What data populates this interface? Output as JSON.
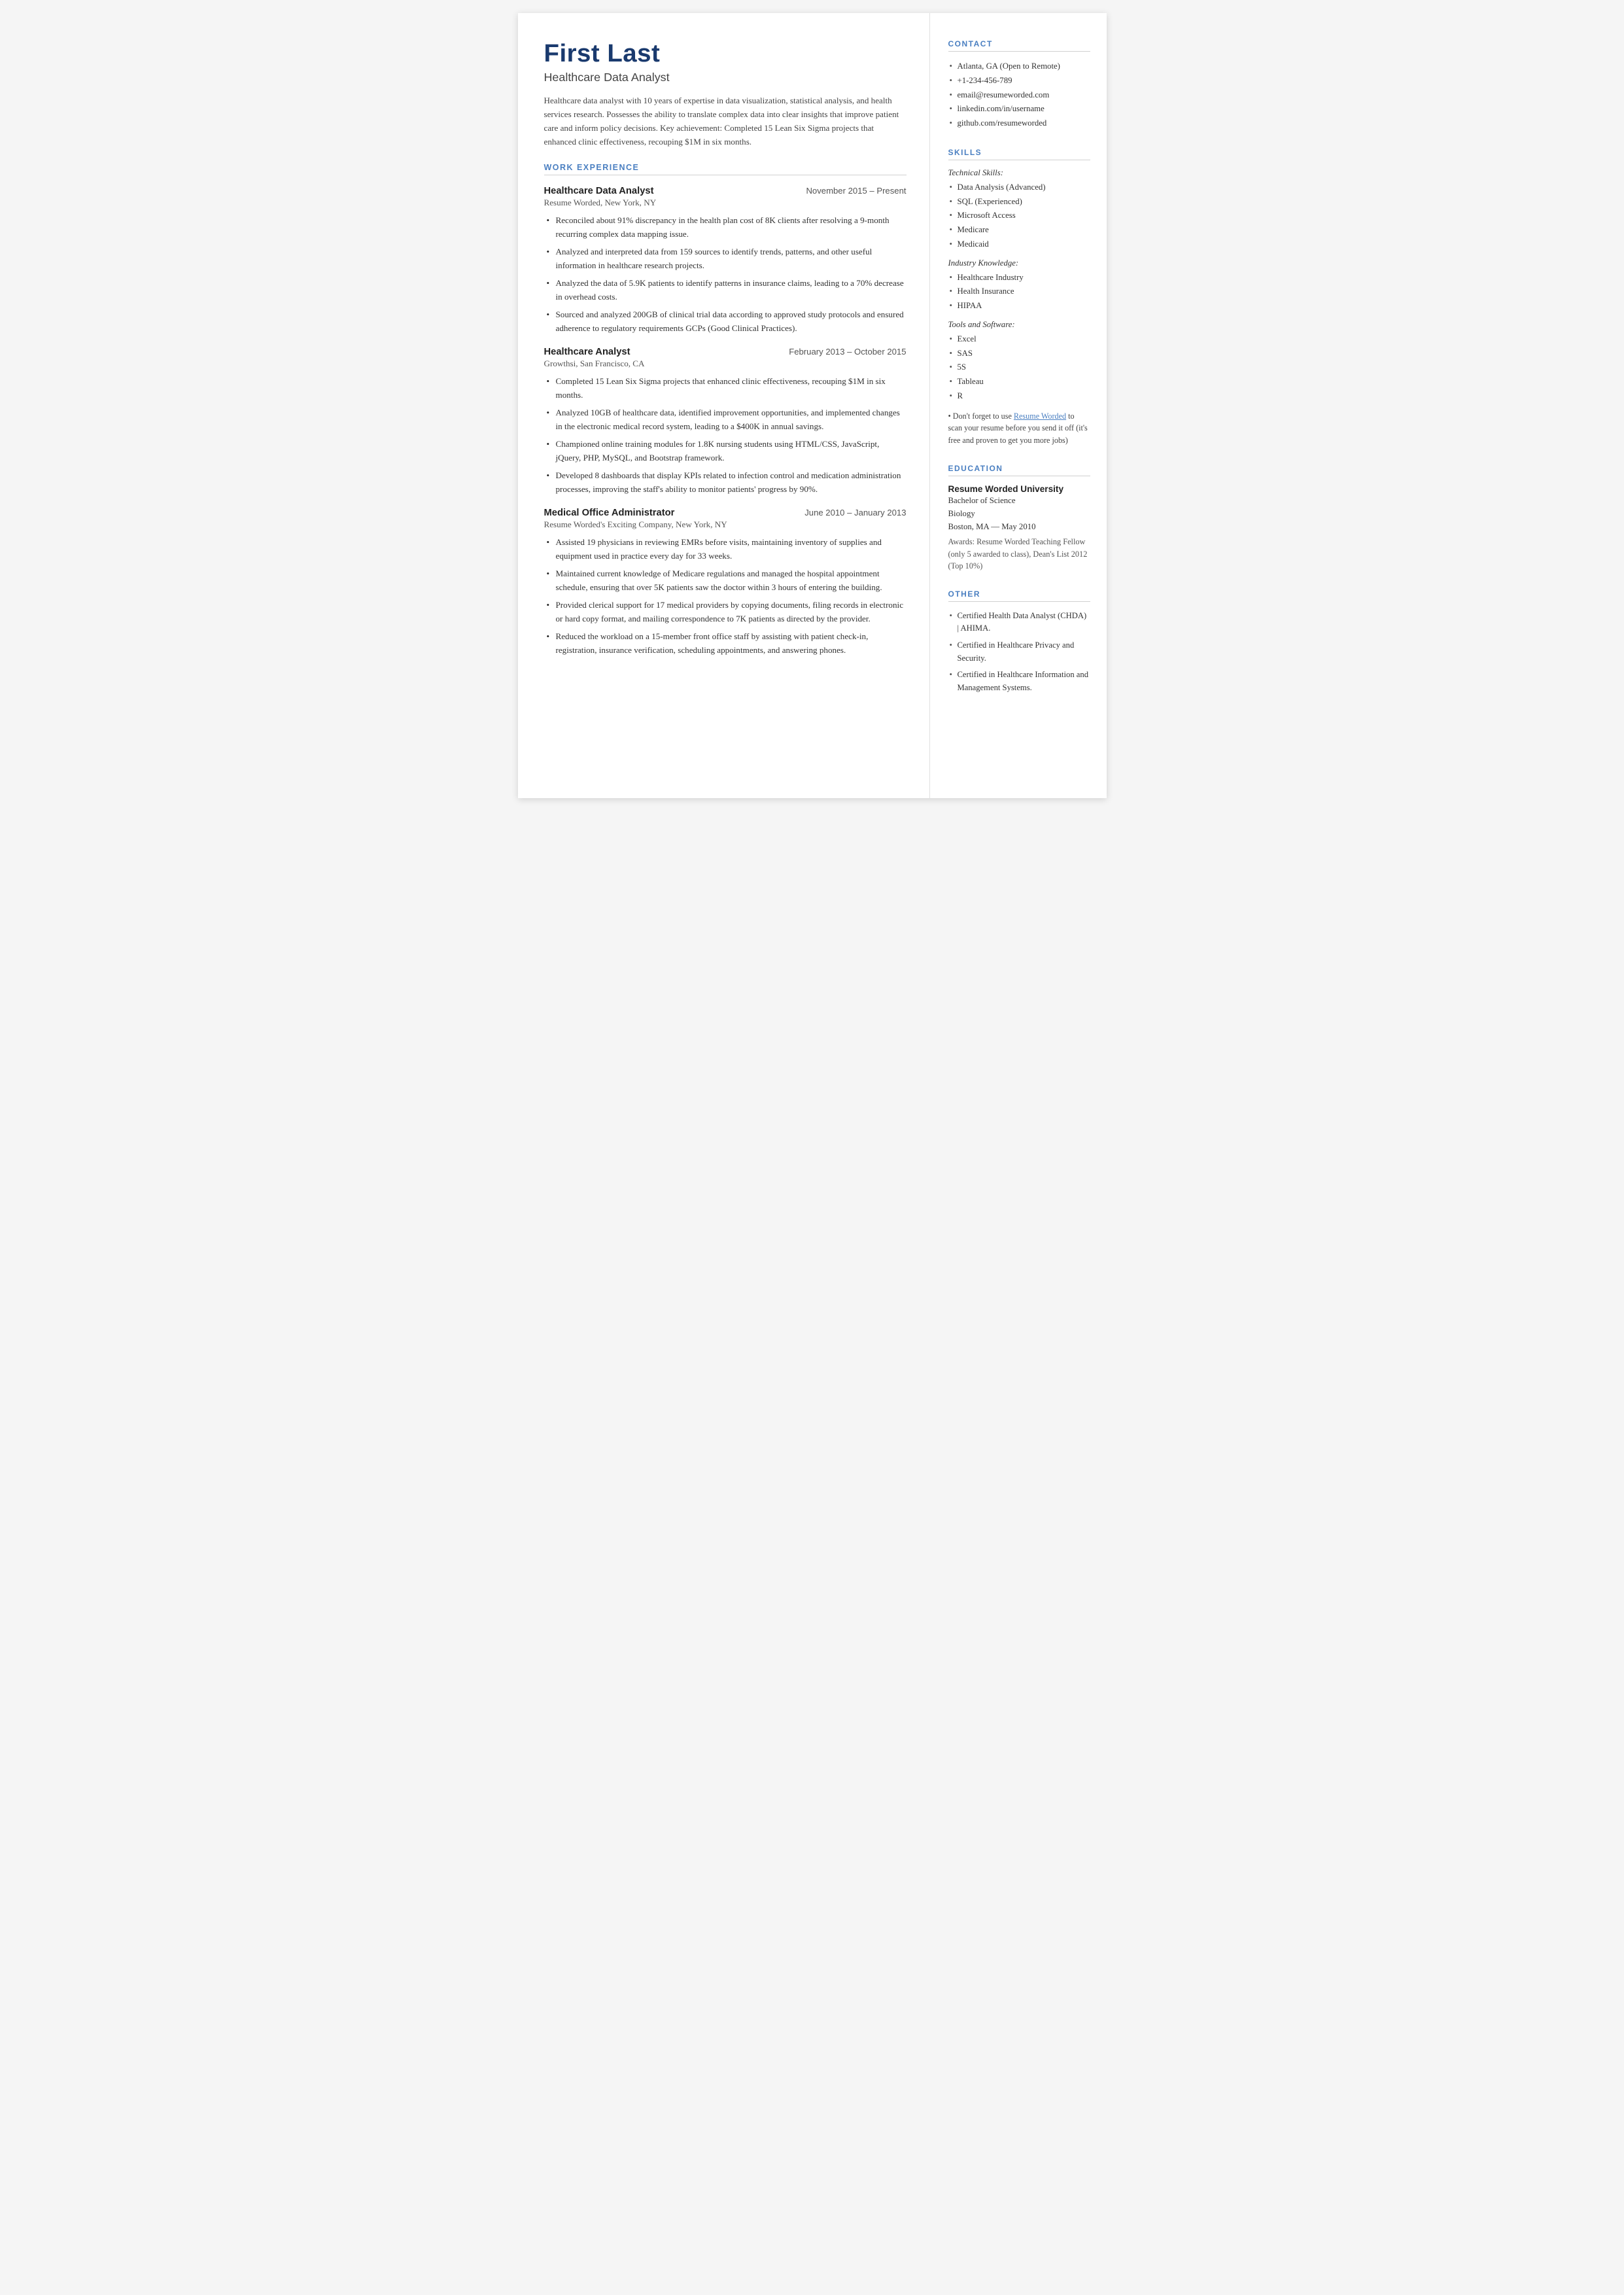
{
  "header": {
    "name": "First Last",
    "title": "Healthcare Data Analyst",
    "summary": "Healthcare data analyst with 10 years of expertise in data visualization, statistical analysis, and health services research. Possesses the ability to translate complex data into clear insights that improve patient care and inform policy decisions. Key achievement: Completed 15 Lean Six Sigma projects that enhanced clinic effectiveness, recouping $1M in six months."
  },
  "sections": {
    "work_experience_label": "WORK EXPERIENCE",
    "jobs": [
      {
        "title": "Healthcare Data Analyst",
        "dates": "November 2015 – Present",
        "company": "Resume Worded, New York, NY",
        "bullets": [
          "Reconciled about 91% discrepancy in the health plan cost of 8K clients after resolving a 9-month recurring complex data mapping issue.",
          "Analyzed and interpreted data from 159 sources to identify trends, patterns, and other useful information in healthcare research projects.",
          "Analyzed the data of 5.9K patients to identify patterns in insurance claims, leading to a 70% decrease in overhead costs.",
          "Sourced and analyzed 200GB of clinical trial data according to approved study protocols and ensured adherence to regulatory requirements GCPs (Good Clinical Practices)."
        ]
      },
      {
        "title": "Healthcare Analyst",
        "dates": "February 2013 – October 2015",
        "company": "Growthsi, San Francisco, CA",
        "bullets": [
          "Completed 15 Lean Six Sigma projects that enhanced clinic effectiveness, recouping $1M in six months.",
          "Analyzed 10GB of healthcare data, identified improvement opportunities, and implemented changes in the electronic medical record system, leading to a $400K in annual savings.",
          "Championed online training modules for 1.8K nursing students using HTML/CSS, JavaScript, jQuery, PHP, MySQL, and Bootstrap framework.",
          "Developed 8 dashboards that display KPIs related to infection control and medication administration processes, improving the staff's ability to monitor patients' progress by 90%."
        ]
      },
      {
        "title": "Medical Office Administrator",
        "dates": "June 2010 – January 2013",
        "company": "Resume Worded's Exciting Company, New York, NY",
        "bullets": [
          "Assisted 19 physicians in reviewing EMRs before visits, maintaining inventory of supplies and equipment used in practice every day for 33 weeks.",
          "Maintained current knowledge of Medicare regulations and managed the hospital appointment schedule, ensuring that over 5K patients saw the doctor within 3 hours of entering the building.",
          "Provided clerical support for 17 medical providers by copying documents, filing records in electronic or hard copy format, and mailing correspondence to 7K patients as directed by the provider.",
          "Reduced the workload on a 15-member front office staff by assisting with patient check-in, registration, insurance verification, scheduling appointments, and answering phones."
        ]
      }
    ]
  },
  "sidebar": {
    "contact_label": "CONTACT",
    "contact_items": [
      "Atlanta, GA (Open to Remote)",
      "+1-234-456-789",
      "email@resumeworded.com",
      "linkedin.com/in/username",
      "github.com/resumeworded"
    ],
    "skills_label": "SKILLS",
    "skills_categories": [
      {
        "category": "Technical Skills:",
        "items": [
          "Data Analysis (Advanced)",
          "SQL (Experienced)",
          "Microsoft Access",
          "Medicare",
          "Medicaid"
        ]
      },
      {
        "category": "Industry Knowledge:",
        "items": [
          "Healthcare Industry",
          "Health Insurance",
          "HIPAA"
        ]
      },
      {
        "category": "Tools and Software:",
        "items": [
          "Excel",
          "SAS",
          "5S",
          "Tableau",
          "R"
        ]
      }
    ],
    "skills_note": "Don't forget to use Resume Worded to scan your resume before you send it off (it's free and proven to get you more jobs)",
    "education_label": "EDUCATION",
    "education": {
      "school": "Resume Worded University",
      "degree": "Bachelor of Science",
      "field": "Biology",
      "location_date": "Boston, MA — May 2010",
      "awards": "Awards: Resume Worded Teaching Fellow (only 5 awarded to class), Dean's List 2012 (Top 10%)"
    },
    "other_label": "OTHER",
    "other_items": [
      "Certified Health Data Analyst (CHDA) | AHIMA.",
      "Certified in Healthcare Privacy and Security.",
      "Certified in Healthcare Information and Management Systems."
    ]
  }
}
